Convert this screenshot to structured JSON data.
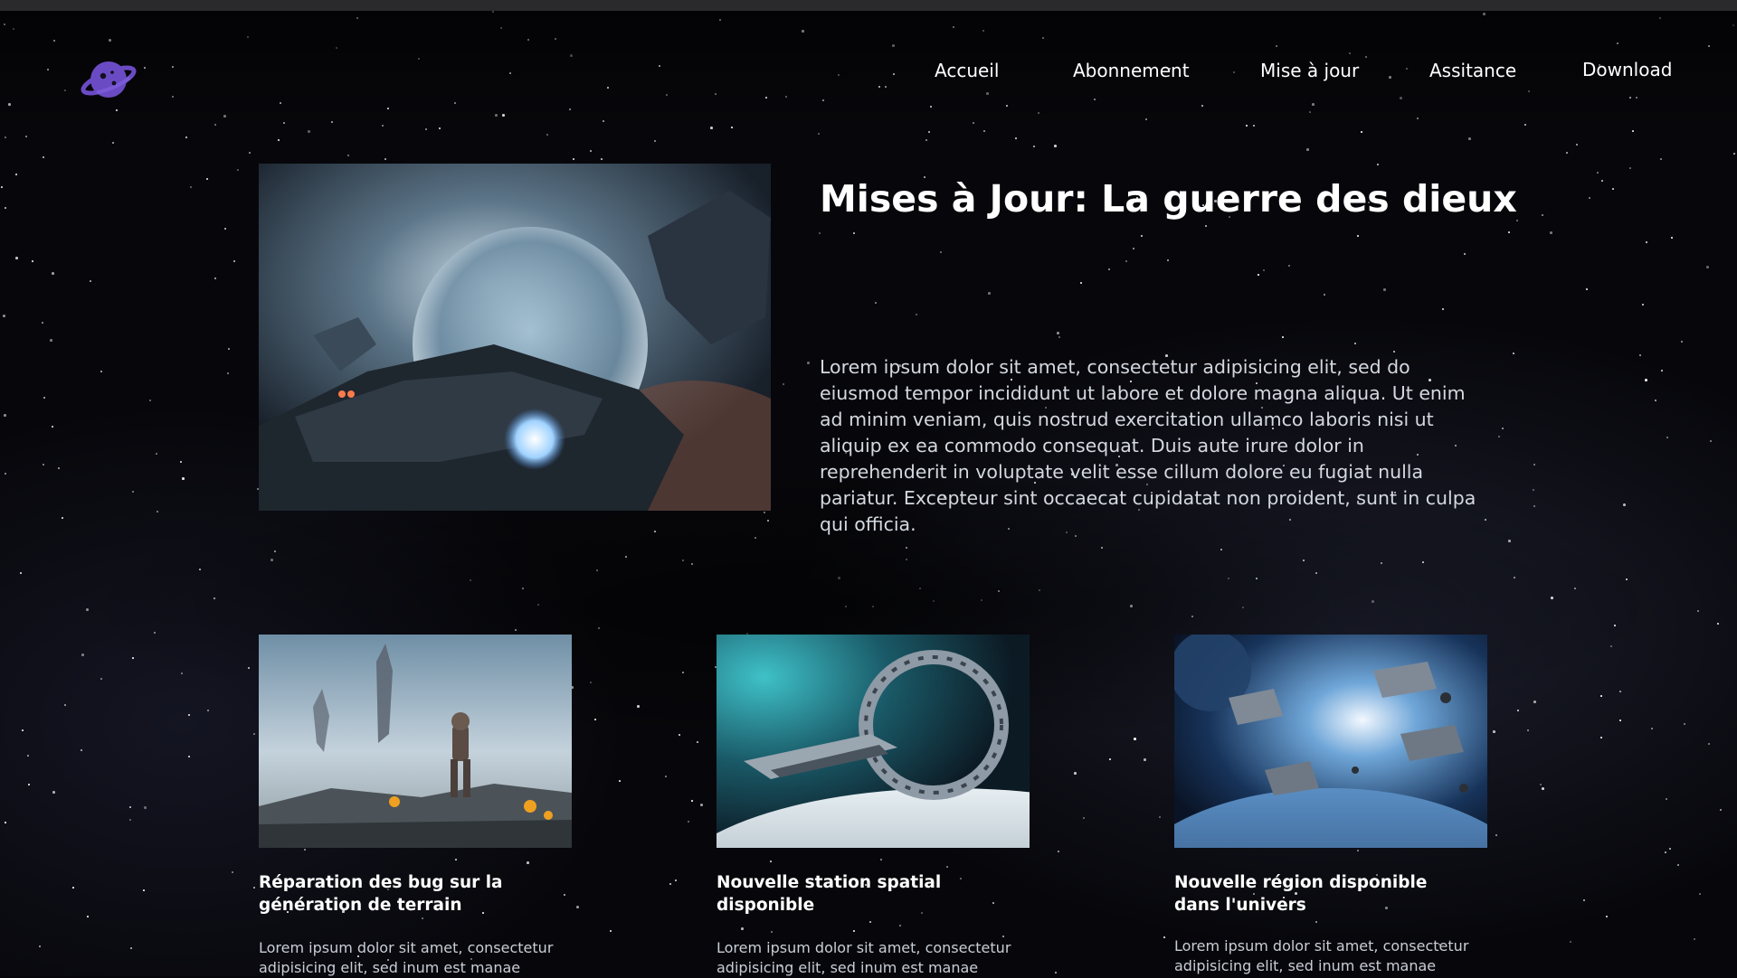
{
  "nav": {
    "logo_icon": "planet-logo-icon",
    "items": [
      {
        "label": "Accueil"
      },
      {
        "label": "Abonnement"
      },
      {
        "label": "Mise à jour"
      },
      {
        "label": "Assitance"
      },
      {
        "label": "Download"
      }
    ]
  },
  "hero": {
    "title": "Mises à Jour: La guerre des dieux",
    "text": "Lorem ipsum dolor sit amet, consectetur adipisicing elit, sed do eiusmod tempor incididunt ut labore et dolore magna aliqua. Ut enim ad minim veniam, quis nostrud exercitation ullamco laboris nisi ut aliquip ex ea commodo consequat. Duis aute irure dolor in reprehenderit in voluptate velit esse cillum dolore eu fugiat nulla pariatur. Excepteur sint occaecat cupidatat non proident, sunt in culpa qui officia."
  },
  "cards": [
    {
      "title": "Réparation des bug sur la génération de terrain",
      "text": "Lorem ipsum dolor sit amet, consectetur adipisicing elit, sed inum est manae"
    },
    {
      "title": "Nouvelle station spatial disponible",
      "text": "Lorem ipsum dolor sit amet, consectetur adipisicing elit, sed inum est manae"
    },
    {
      "title": "Nouvelle région disponible dans l'univers",
      "text": "Lorem ipsum dolor sit amet, consectetur adipisicing elit, sed inum est manae"
    }
  ],
  "colors": {
    "accent": "#6a4bc4",
    "background": "#07070b"
  }
}
